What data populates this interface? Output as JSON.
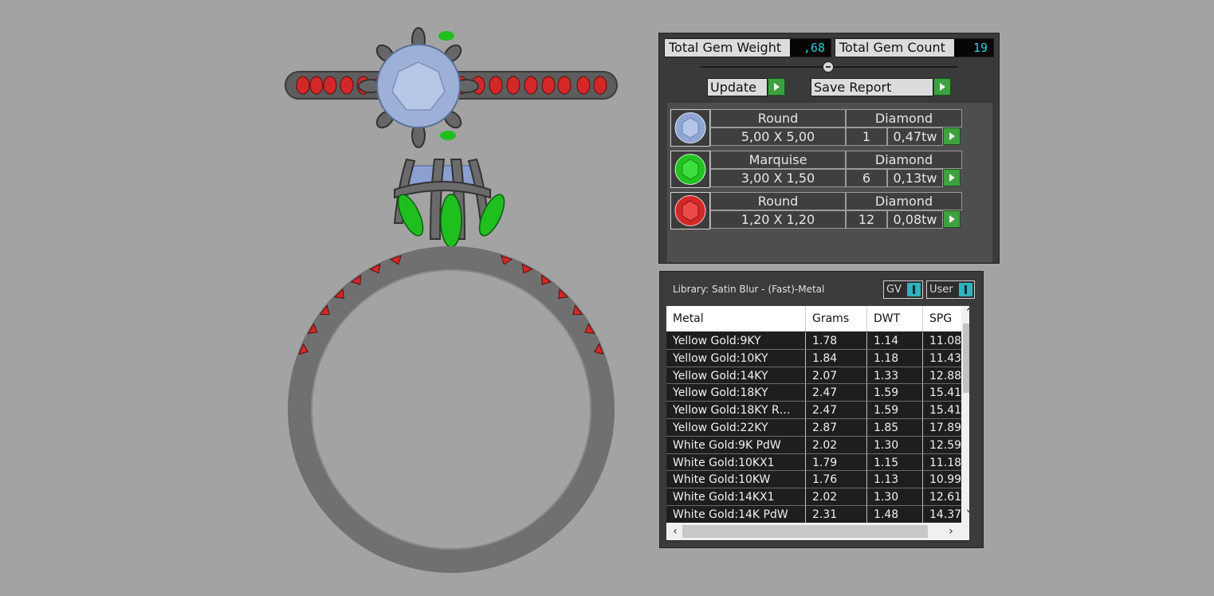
{
  "gem_stats": {
    "total_weight_label": "Total Gem Weight",
    "total_weight_value": ",68",
    "total_count_label": "Total Gem Count",
    "total_count_value": "19"
  },
  "actions": {
    "update_label": "Update",
    "save_report_label": "Save Report"
  },
  "gems": [
    {
      "shape": "Round",
      "material": "Diamond",
      "size": "5,00 X 5,00",
      "count": "1",
      "weight": "0,47tw",
      "color": "#8fa6d4"
    },
    {
      "shape": "Marquise",
      "material": "Diamond",
      "size": "3,00 X 1,50",
      "count": "6",
      "weight": "0,13tw",
      "color": "#22c322"
    },
    {
      "shape": "Round",
      "material": "Diamond",
      "size": "1,20 X 1,20",
      "count": "12",
      "weight": "0,08tw",
      "color": "#d42828"
    }
  ],
  "library": {
    "label": "Library: Satin Blur - (Fast)-Metal",
    "toggle_gv": "GV",
    "toggle_user": "User"
  },
  "metal_table": {
    "columns": [
      "Metal",
      "Grams",
      "DWT",
      "SPG"
    ],
    "rows": [
      [
        "Yellow Gold:9KY",
        "1.78",
        "1.14",
        "11.08"
      ],
      [
        "Yellow Gold:10KY",
        "1.84",
        "1.18",
        "11.43"
      ],
      [
        "Yellow Gold:14KY",
        "2.07",
        "1.33",
        "12.88"
      ],
      [
        "Yellow Gold:18KY",
        "2.47",
        "1.59",
        "15.41"
      ],
      [
        "Yellow Gold:18KY R…",
        "2.47",
        "1.59",
        "15.41"
      ],
      [
        "Yellow Gold:22KY",
        "2.87",
        "1.85",
        "17.89"
      ],
      [
        "White Gold:9K PdW",
        "2.02",
        "1.30",
        "12.59"
      ],
      [
        "White Gold:10KX1",
        "1.79",
        "1.15",
        "11.18"
      ],
      [
        "White Gold:10KW",
        "1.76",
        "1.13",
        "10.99"
      ],
      [
        "White Gold:14KX1",
        "2.02",
        "1.30",
        "12.61"
      ],
      [
        "White Gold:14K PdW",
        "2.31",
        "1.48",
        "14.37"
      ]
    ]
  },
  "colors": {
    "center_stone": "#8fa6d4",
    "marquise": "#22c322",
    "accent_stone": "#d42828",
    "metal": "#6e6e6e"
  }
}
